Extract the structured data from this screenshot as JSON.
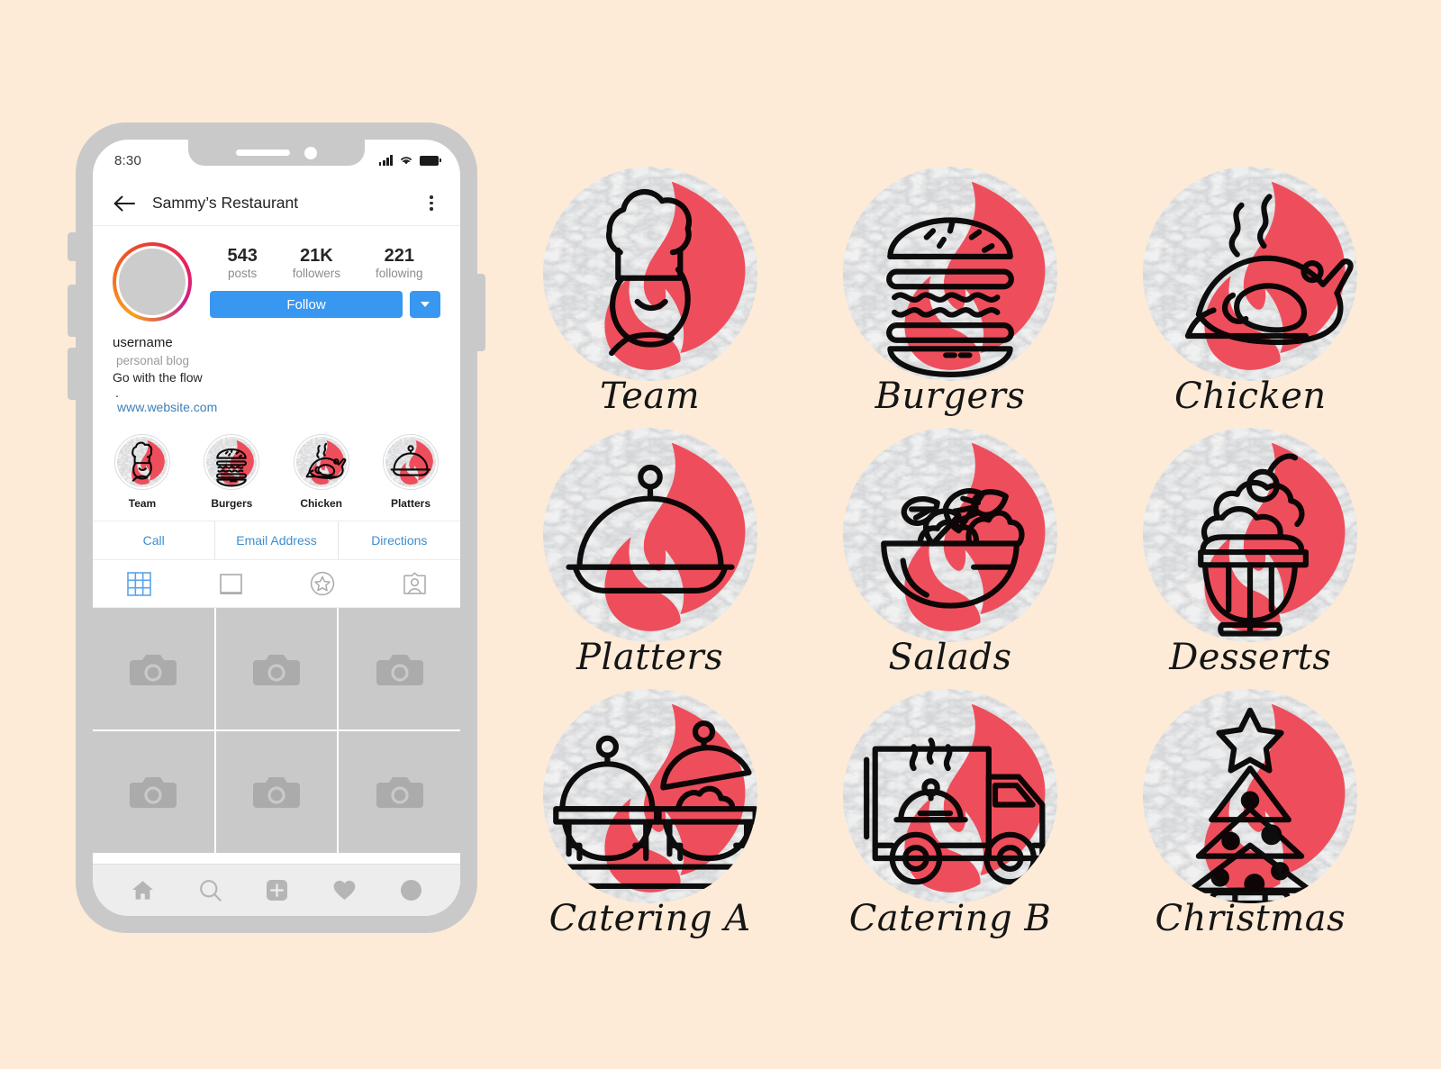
{
  "page": {
    "background_color": "#FDEBD7",
    "accent_red": "#EE4E5C",
    "ink": "#151515"
  },
  "phone": {
    "status_bar": {
      "time": "8:30",
      "signal_icon": "signal-bars-icon",
      "wifi_icon": "wifi-icon",
      "battery_icon": "battery-icon"
    },
    "header": {
      "back_icon": "back-arrow-icon",
      "title": "Sammy’s Restaurant",
      "menu_icon": "kebab-menu-icon"
    },
    "profile": {
      "avatar_name": "profile-avatar",
      "stats": [
        {
          "value": "543",
          "label": "posts"
        },
        {
          "value": "21K",
          "label": "followers"
        },
        {
          "value": "221",
          "label": "following"
        }
      ],
      "follow_label": "Follow",
      "dropdown_icon": "chevron-down-icon",
      "bio": {
        "username": "username",
        "category": "personal blog",
        "line1": "Go with the flow",
        "line2": ".",
        "website": "www.website.com"
      }
    },
    "highlights": [
      {
        "label": "Team",
        "icon": "chef-icon"
      },
      {
        "label": "Burgers",
        "icon": "burger-icon"
      },
      {
        "label": "Chicken",
        "icon": "roast-chicken-icon"
      },
      {
        "label": "Platters",
        "icon": "cloche-icon"
      }
    ],
    "contact_buttons": [
      {
        "label": "Call",
        "icon": "phone-icon"
      },
      {
        "label": "Email Address",
        "icon": "mail-icon"
      },
      {
        "label": "Directions",
        "icon": "map-pin-icon"
      }
    ],
    "tabs": [
      {
        "name": "grid-tab",
        "icon": "grid-icon",
        "active": true
      },
      {
        "name": "reels-tab",
        "icon": "square-frame-icon",
        "active": false
      },
      {
        "name": "guides-tab",
        "icon": "star-circle-icon",
        "active": false
      },
      {
        "name": "tagged-tab",
        "icon": "person-card-icon",
        "active": false
      }
    ],
    "grid": {
      "placeholder_icon": "camera-icon",
      "cells": 6
    },
    "bottom_nav": [
      {
        "name": "home-nav",
        "icon": "home-icon"
      },
      {
        "name": "search-nav",
        "icon": "search-icon"
      },
      {
        "name": "add-post-nav",
        "icon": "plus-square-icon"
      },
      {
        "name": "activity-nav",
        "icon": "heart-icon"
      },
      {
        "name": "profile-nav",
        "icon": "avatar-circle-icon"
      }
    ]
  },
  "covers": [
    {
      "label": "Team",
      "icon": "chef-icon"
    },
    {
      "label": "Burgers",
      "icon": "burger-icon"
    },
    {
      "label": "Chicken",
      "icon": "roast-chicken-icon"
    },
    {
      "label": "Platters",
      "icon": "cloche-icon"
    },
    {
      "label": "Salads",
      "icon": "salad-bowl-icon"
    },
    {
      "label": "Desserts",
      "icon": "ice-cream-sundae-icon"
    },
    {
      "label": "Catering A",
      "icon": "chafing-dishes-icon"
    },
    {
      "label": "Catering B",
      "icon": "food-truck-icon"
    },
    {
      "label": "Christmas",
      "icon": "christmas-tree-icon"
    }
  ]
}
